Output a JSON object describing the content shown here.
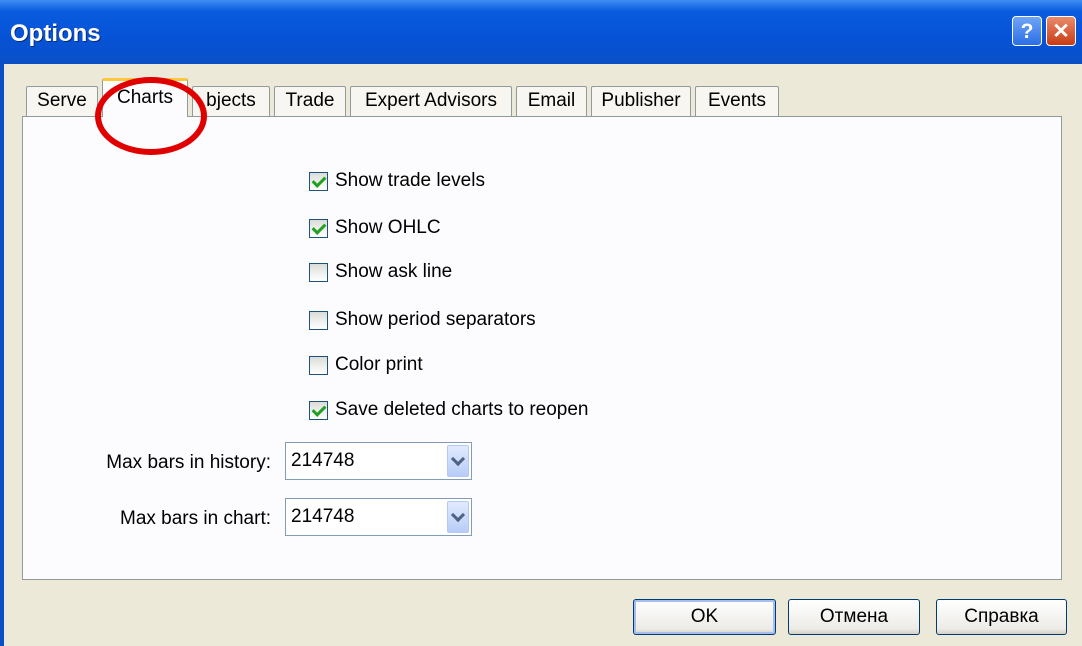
{
  "window": {
    "title": "Options",
    "help_icon": "?",
    "close_icon": "✕"
  },
  "tabs": [
    {
      "label": "Serve"
    },
    {
      "label": "Charts"
    },
    {
      "label": "bjects"
    },
    {
      "label": "Trade"
    },
    {
      "label": "Expert Advisors"
    },
    {
      "label": "Email"
    },
    {
      "label": "Publisher"
    },
    {
      "label": "Events"
    }
  ],
  "active_tab": "Charts",
  "charts_options": {
    "checkboxes": [
      {
        "label": "Show trade levels",
        "checked": true
      },
      {
        "label": "Show OHLC",
        "checked": true
      },
      {
        "label": "Show ask line",
        "checked": false
      },
      {
        "label": "Show period separators",
        "checked": false
      },
      {
        "label": "Color print",
        "checked": false
      },
      {
        "label": "Save deleted charts to reopen",
        "checked": true
      }
    ],
    "max_bars_history": {
      "label": "Max bars in history:",
      "value": "214748"
    },
    "max_bars_chart": {
      "label": "Max bars in chart:",
      "value": "214748"
    }
  },
  "buttons": {
    "ok": "OK",
    "cancel": "Отмена",
    "help": "Справка"
  },
  "colors": {
    "titlebar": "#0A5BDE",
    "annotation": "#E00000",
    "check": "#21A121",
    "active_tab_accent": "#FFC83C"
  }
}
